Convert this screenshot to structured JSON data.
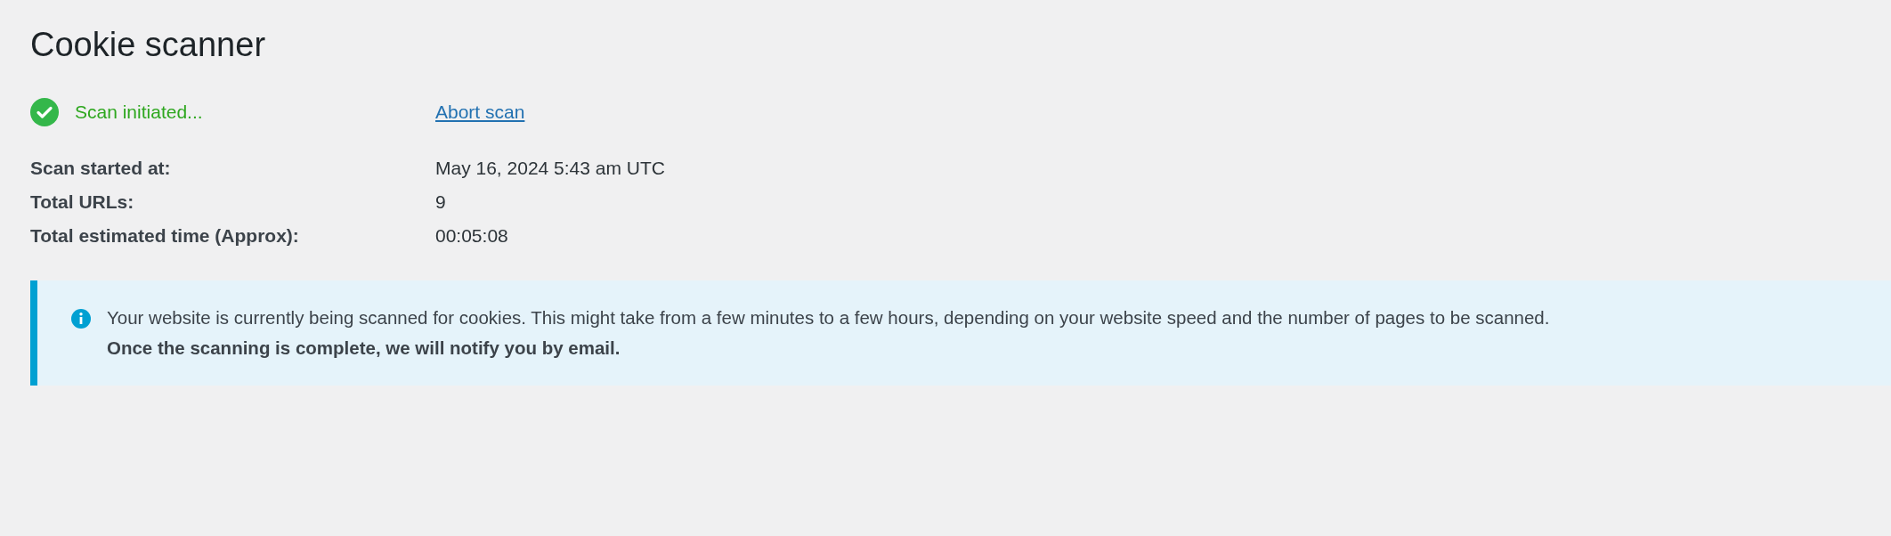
{
  "title": "Cookie scanner",
  "status": {
    "kind": "success",
    "text": "Scan initiated...",
    "link": "Abort scan"
  },
  "details": [
    {
      "label": "Scan started at:",
      "value": "May 16, 2024 5:43 am UTC"
    },
    {
      "label": "Total URLs:",
      "value": "9"
    },
    {
      "label": "Total estimated time (Approx):",
      "value": "00:05:08"
    }
  ],
  "notice": {
    "kind": "info",
    "message": "Your website is currently being scanned for cookies. This might take from a few minutes to a few hours, depending on your website speed and the number of pages to be scanned.",
    "emphasis": "Once the scanning is complete, we will notify you by email."
  }
}
